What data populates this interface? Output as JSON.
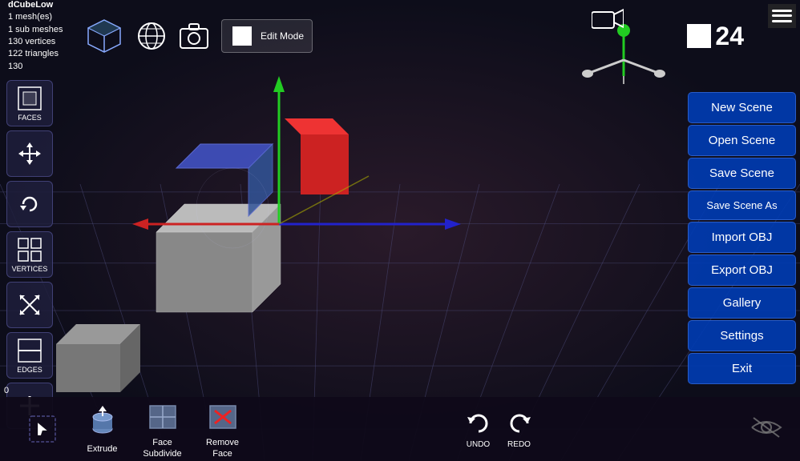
{
  "info": {
    "object_name": "dCubeLow",
    "meshes": "1 mesh(es)",
    "sub_meshes": "1 sub meshes",
    "vertices": "130 vertices",
    "triangles": "122 triangles",
    "extra": "130"
  },
  "toolbar": {
    "edit_mode_label": "Edit Mode",
    "frame_number": "24",
    "screenshot_label": "Screenshot",
    "globe_label": "Globe"
  },
  "left_tools": [
    {
      "id": "faces",
      "label": "FACES",
      "active": false
    },
    {
      "id": "move",
      "label": "Move",
      "active": false
    },
    {
      "id": "rotate",
      "label": "Rotate",
      "active": false
    },
    {
      "id": "vertices",
      "label": "VERTICES",
      "active": false
    },
    {
      "id": "scale",
      "label": "Scale",
      "active": false
    },
    {
      "id": "edges",
      "label": "EDGES",
      "active": false
    },
    {
      "id": "add",
      "label": "Add",
      "active": false
    }
  ],
  "right_menu": {
    "buttons": [
      {
        "id": "new-scene",
        "label": "New Scene"
      },
      {
        "id": "open-scene",
        "label": "Open Scene"
      },
      {
        "id": "save-scene",
        "label": "Save Scene"
      },
      {
        "id": "save-scene-as",
        "label": "Save Scene As"
      },
      {
        "id": "import-obj",
        "label": "Import OBJ"
      },
      {
        "id": "export-obj",
        "label": "Export OBJ"
      },
      {
        "id": "gallery",
        "label": "Gallery"
      },
      {
        "id": "settings",
        "label": "Settings"
      },
      {
        "id": "exit",
        "label": "Exit"
      }
    ]
  },
  "bottom_tools": [
    {
      "id": "select",
      "label": "Select",
      "icon": "select"
    },
    {
      "id": "extrude",
      "label": "Extrude",
      "icon": "extrude"
    },
    {
      "id": "face-subdivide",
      "label": "Face Subdivide",
      "icon": "subdivide"
    },
    {
      "id": "remove-face",
      "label": "Remove Face",
      "icon": "remove"
    }
  ],
  "undo_redo": {
    "undo_label": "UNDO",
    "redo_label": "REDO"
  },
  "coords": "0",
  "visibility": {
    "label": "Visibility"
  },
  "colors": {
    "menu_bg": "#0040c0",
    "toolbar_bg": "#0f0a19",
    "accent_blue": "#3355ff"
  }
}
